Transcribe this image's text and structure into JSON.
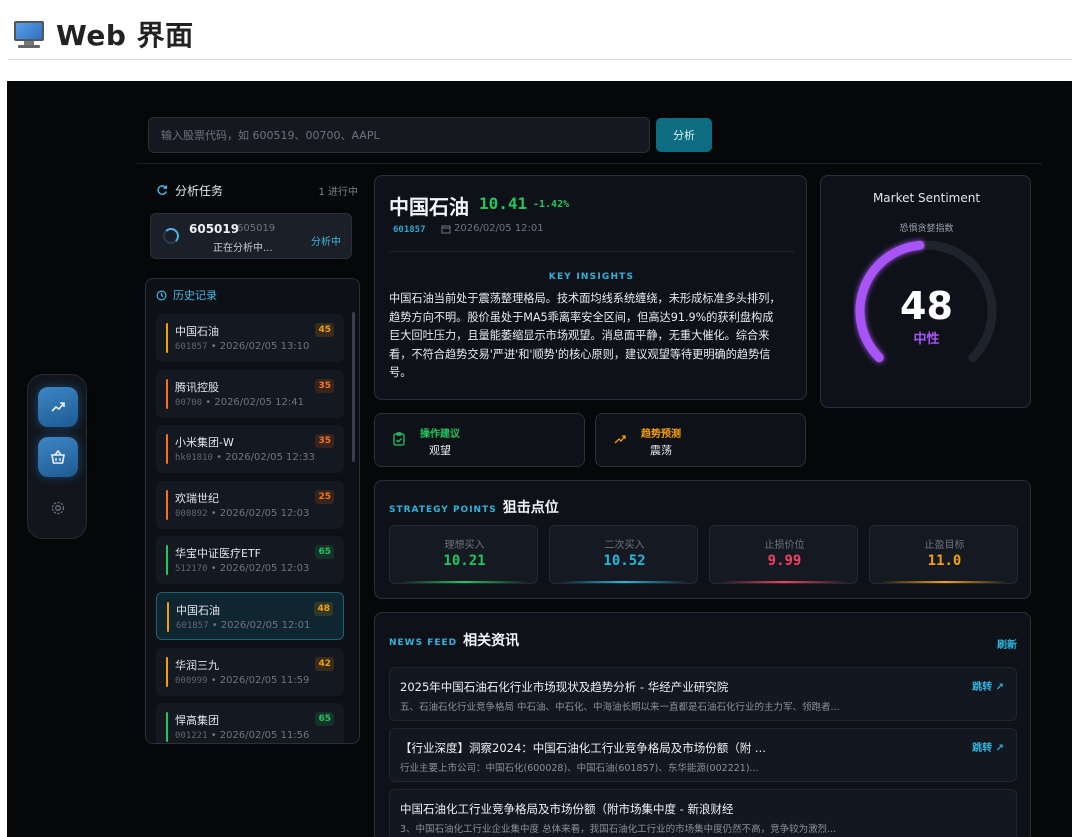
{
  "page": {
    "title": "Web 界面",
    "icon": "monitor-icon"
  },
  "search": {
    "placeholder": "输入股票代码，如 600519、00700、AAPL",
    "button": "分析"
  },
  "rail": {
    "items": [
      "trending-icon",
      "basket-icon",
      "gear-icon"
    ]
  },
  "tasks": {
    "title": "分析任务",
    "count": "1 进行中",
    "item": {
      "code": "605019",
      "code_sub": "605019",
      "status": "正在分析中...",
      "tag": "分析中"
    }
  },
  "history": {
    "title": "历史记录",
    "items": [
      {
        "name": "中国石油",
        "code": "601857",
        "time": "2026/02/05 13:10",
        "score": "45",
        "color": "#f59e0b"
      },
      {
        "name": "腾讯控股",
        "code": "00700",
        "time": "2026/02/05 12:41",
        "score": "35",
        "color": "#f97316"
      },
      {
        "name": "小米集团-W",
        "code": "hk01810",
        "time": "2026/02/05 12:33",
        "score": "35",
        "color": "#f97316"
      },
      {
        "name": "欢瑞世纪",
        "code": "000892",
        "time": "2026/02/05 12:03",
        "score": "25",
        "color": "#f97316"
      },
      {
        "name": "华宝中证医疗ETF",
        "code": "512170",
        "time": "2026/02/05 12:03",
        "score": "65",
        "color": "#22c55e"
      },
      {
        "name": "中国石油",
        "code": "601857",
        "time": "2026/02/05 12:01",
        "score": "48",
        "color": "#f59e0b"
      },
      {
        "name": "华润三九",
        "code": "000999",
        "time": "2026/02/05 11:59",
        "score": "42",
        "color": "#f59e0b"
      },
      {
        "name": "悍高集团",
        "code": "001221",
        "time": "2026/02/05 11:56",
        "score": "65",
        "color": "#22c55e"
      }
    ]
  },
  "stock": {
    "name": "中国石油",
    "price": "10.41",
    "change": "-1.42%",
    "code": "601857",
    "date": "2026/02/05 12:01",
    "insights_title": "KEY INSIGHTS",
    "insights": "中国石油当前处于震荡整理格局。技术面均线系统缠绕，未形成标准多头排列，趋势方向不明。股价虽处于MA5乖离率安全区间，但高达91.9%的获利盘构成巨大回吐压力，且量能萎缩显示市场观望。消息面平静，无重大催化。综合来看，不符合趋势交易'严进'和'顺势'的核心原则，建议观望等待更明确的趋势信号。"
  },
  "sentiment": {
    "title": "Market Sentiment",
    "subtitle": "恐惧贪婪指数",
    "value": 48,
    "label": "中性",
    "color": "#a855f7"
  },
  "actions": {
    "advice": {
      "label": "操作建议",
      "value": "观望",
      "color": "#22c55e"
    },
    "trend": {
      "label": "趋势预测",
      "value": "震荡",
      "color": "#f59e0b"
    }
  },
  "strategy": {
    "title_en": "STRATEGY POINTS",
    "title_zh": "狙击点位",
    "points": [
      {
        "label": "理想买入",
        "value": "10.21",
        "color": "#22c55e"
      },
      {
        "label": "二次买入",
        "value": "10.52",
        "color": "#22b8d9"
      },
      {
        "label": "止损价位",
        "value": "9.99",
        "color": "#f43f5e"
      },
      {
        "label": "止盈目标",
        "value": "11.0",
        "color": "#f59e0b"
      }
    ]
  },
  "news": {
    "title_en": "NEWS FEED",
    "title_zh": "相关资讯",
    "refresh": "刷新",
    "items": [
      {
        "title": "2025年中国石油石化行业市场现状及趋势分析 - 华经产业研究院",
        "snippet": "五、石油石化行业竞争格局 中石油、中石化、中海油长期以来一直都是石油石化行业的主力军、领跑者...",
        "link": "跳转 ↗"
      },
      {
        "title": "【行业深度】洞察2024：中国石油化工行业竞争格局及市场份额（附 ...",
        "snippet": "行业主要上市公司：中国石化(600028)、中国石油(601857)、东华能源(002221)...",
        "link": "跳转 ↗"
      },
      {
        "title": "中国石油化工行业竞争格局及市场份额（附市场集中度 - 新浪财经",
        "snippet": "3、中国石油化工行业企业集中度 总体来看，我国石油化工行业的市场集中度仍然不高，竞争较为激烈...",
        "link": ""
      }
    ]
  }
}
